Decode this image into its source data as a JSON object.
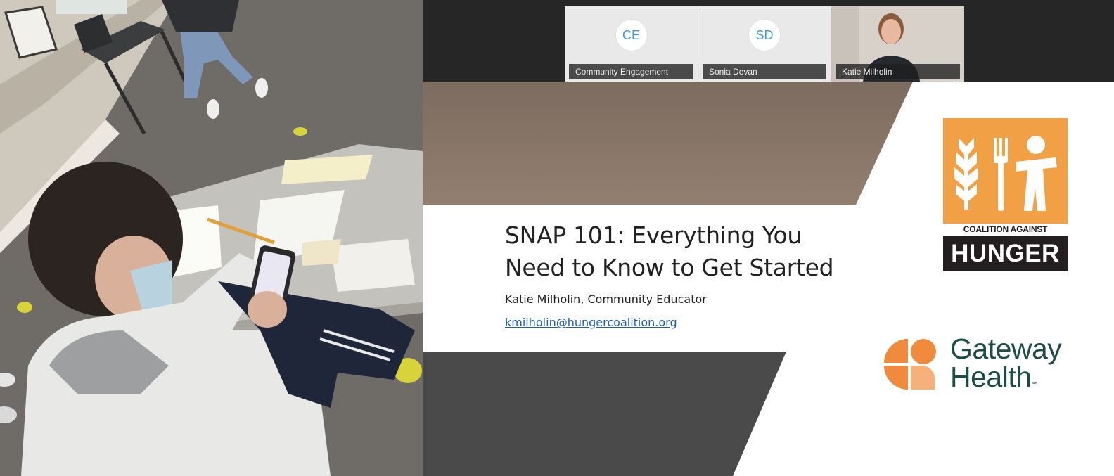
{
  "participants": [
    {
      "initials": "CE",
      "name": "Community Engagement",
      "video": false
    },
    {
      "initials": "SD",
      "name": "Sonia Devan",
      "video": false
    },
    {
      "initials": "",
      "name": "Katie Milholin",
      "video": true
    }
  ],
  "slide": {
    "title_line1": "SNAP 101: Everything You",
    "title_line2": "Need to Know to Get Started",
    "presenter": "Katie Milholin, Community Educator",
    "email": "kmilholin@hungercoalition.org",
    "logo1": {
      "line1": "COALITION AGAINST",
      "line2": "HUNGER",
      "color": "#f2a045"
    },
    "logo2": {
      "line1": "Gateway",
      "line2": "Health",
      "mark": "℠",
      "color": "#1d4e45"
    }
  },
  "colors": {
    "brand_orange": "#f2a045",
    "slide_brown": "#8a7a6d",
    "slide_gray": "#4a4a4a",
    "link_blue": "#1f5fb4"
  }
}
